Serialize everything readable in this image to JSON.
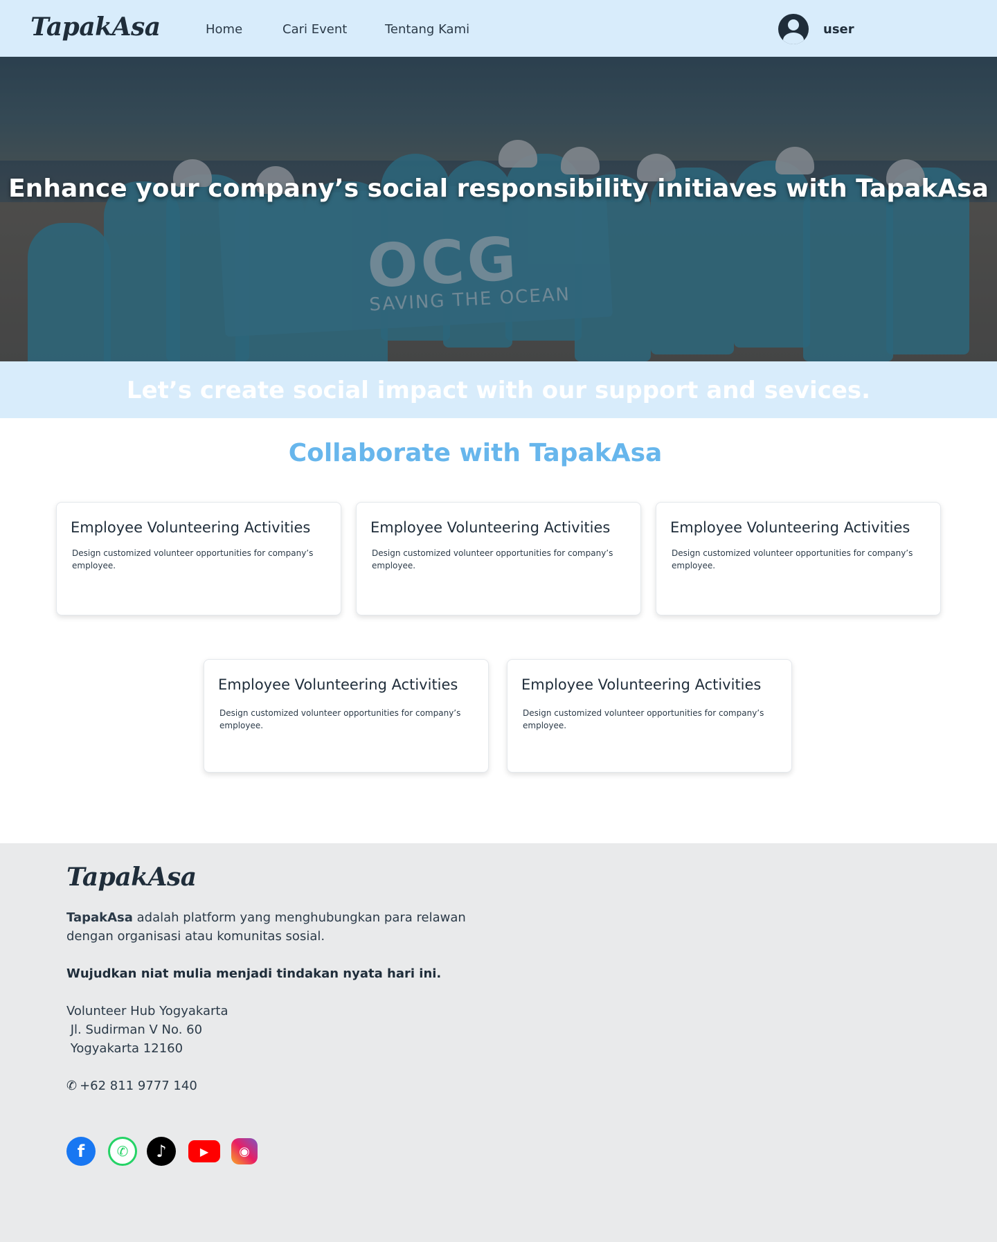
{
  "nav": {
    "logo": "TapakAsa",
    "links": [
      "Home",
      "Cari Event",
      "Tentang Kami"
    ],
    "user_label": "user"
  },
  "hero": {
    "title": "Enhance your company’s social responsibility initiaves with TapakAsa",
    "banner_text": "OCG",
    "banner_sub": "SAVING THE OCEAN"
  },
  "slogan": "Let’s create social impact with our support and sevices.",
  "section": {
    "title": "Collaborate with TapakAsa",
    "cards": [
      {
        "title": "Employee Volunteering Activities",
        "desc": "Design customized volunteer opportunities for company’s employee."
      },
      {
        "title": "Employee Volunteering Activities",
        "desc": "Design customized volunteer opportunities for company’s employee."
      },
      {
        "title": "Employee Volunteering Activities",
        "desc": "Design customized volunteer opportunities for company’s employee."
      },
      {
        "title": "Employee Volunteering Activities",
        "desc": "Design customized volunteer opportunities for company’s employee."
      },
      {
        "title": "Employee Volunteering Activities",
        "desc": "Design customized volunteer opportunities for company’s employee."
      }
    ]
  },
  "footer": {
    "logo": "TapakAsa",
    "about_brand": "TapakAsa",
    "about_rest": "adalah platform yang menghubungkan para relawan dengan organisasi atau komunitas sosial.",
    "tagline": "Wujudkan niat mulia menjadi tindakan nyata hari ini.",
    "address_lines": [
      "Volunteer Hub Yogyakarta",
      " Jl. Sudirman V No. 60",
      " Yogyakarta 12160"
    ],
    "phone": "+62 811 9777 140",
    "socials": [
      "facebook-icon",
      "whatsapp-icon",
      "tiktok-icon",
      "youtube-icon",
      "instagram-icon"
    ]
  },
  "colors": {
    "nav_bg": "#d8ecfb",
    "accent": "#67b6ec",
    "footer_bg": "#e9eaeb",
    "text_dark": "#1f2d3a"
  }
}
